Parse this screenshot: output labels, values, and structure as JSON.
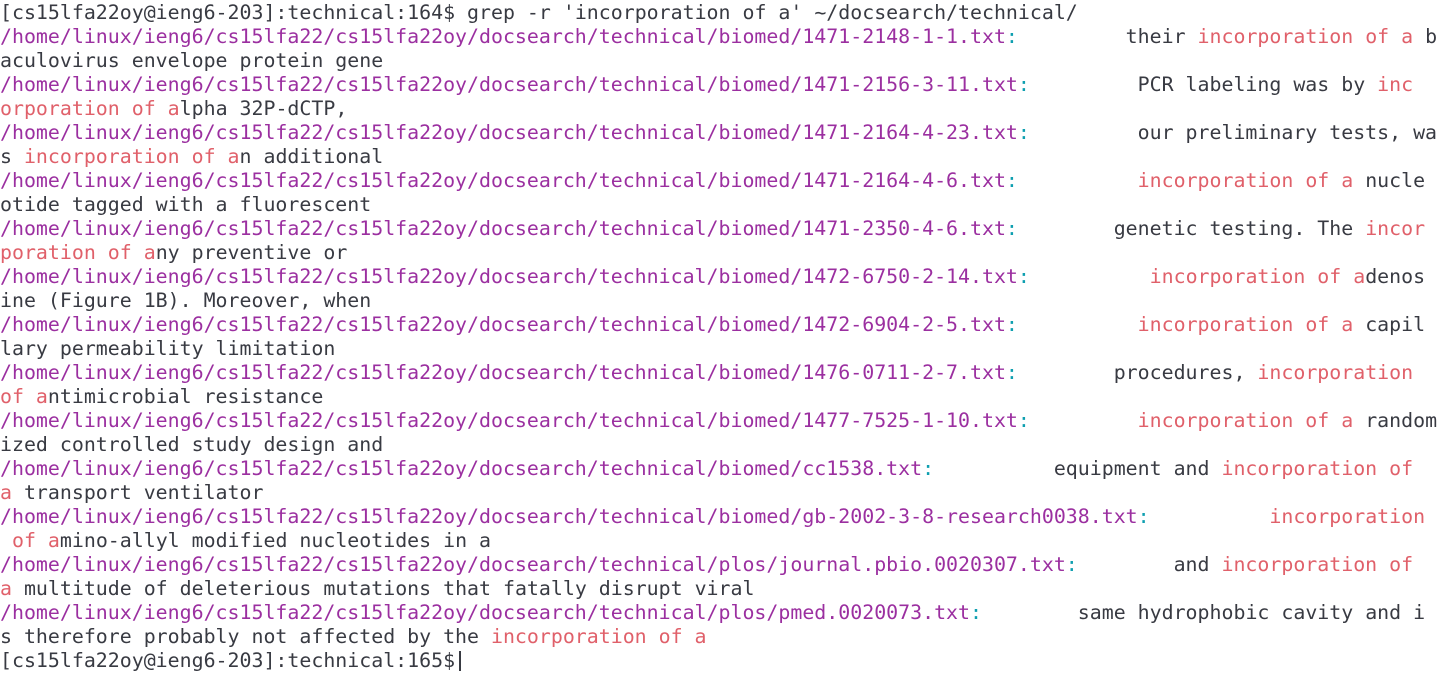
{
  "terminal": {
    "prompt_command": {
      "prompt": "[cs15lfa22oy@ieng6-203]:technical:164$ ",
      "command": "grep -r 'incorporation of a' ~/docsearch/technical/"
    },
    "results": [
      {
        "row1": [
          {
            "k": "path",
            "t": "/home/linux/ieng6/cs15lfa22/cs15lfa22oy/docsearch/technical/biomed/1471-2148-1-1.txt"
          },
          {
            "k": "sep",
            "t": ":"
          },
          {
            "k": "txt",
            "t": "         their "
          },
          {
            "k": "match",
            "t": "incorporation of a"
          },
          {
            "k": "txt",
            "t": " b"
          }
        ],
        "row2": [
          {
            "k": "txt",
            "t": "aculovirus envelope protein gene"
          }
        ]
      },
      {
        "row1": [
          {
            "k": "path",
            "t": "/home/linux/ieng6/cs15lfa22/cs15lfa22oy/docsearch/technical/biomed/1471-2156-3-11.txt"
          },
          {
            "k": "sep",
            "t": ":"
          },
          {
            "k": "txt",
            "t": "         PCR labeling was by "
          },
          {
            "k": "match",
            "t": "inc"
          }
        ],
        "row2": [
          {
            "k": "match",
            "t": "orporation of a"
          },
          {
            "k": "txt",
            "t": "lpha 32P-dCTP,"
          }
        ]
      },
      {
        "row1": [
          {
            "k": "path",
            "t": "/home/linux/ieng6/cs15lfa22/cs15lfa22oy/docsearch/technical/biomed/1471-2164-4-23.txt"
          },
          {
            "k": "sep",
            "t": ":"
          },
          {
            "k": "txt",
            "t": "         our preliminary tests, wa"
          }
        ],
        "row2": [
          {
            "k": "txt",
            "t": "s "
          },
          {
            "k": "match",
            "t": "incorporation of a"
          },
          {
            "k": "txt",
            "t": "n additional"
          }
        ]
      },
      {
        "row1": [
          {
            "k": "path",
            "t": "/home/linux/ieng6/cs15lfa22/cs15lfa22oy/docsearch/technical/biomed/1471-2164-4-6.txt"
          },
          {
            "k": "sep",
            "t": ":"
          },
          {
            "k": "txt",
            "t": "          "
          },
          {
            "k": "match",
            "t": "incorporation of a"
          },
          {
            "k": "txt",
            "t": " nucle"
          }
        ],
        "row2": [
          {
            "k": "txt",
            "t": "otide tagged with a fluorescent"
          }
        ]
      },
      {
        "row1": [
          {
            "k": "path",
            "t": "/home/linux/ieng6/cs15lfa22/cs15lfa22oy/docsearch/technical/biomed/1471-2350-4-6.txt"
          },
          {
            "k": "sep",
            "t": ":"
          },
          {
            "k": "txt",
            "t": "        genetic testing. The "
          },
          {
            "k": "match",
            "t": "incor"
          }
        ],
        "row2": [
          {
            "k": "match",
            "t": "poration of a"
          },
          {
            "k": "txt",
            "t": "ny preventive or"
          }
        ]
      },
      {
        "row1": [
          {
            "k": "path",
            "t": "/home/linux/ieng6/cs15lfa22/cs15lfa22oy/docsearch/technical/biomed/1472-6750-2-14.txt"
          },
          {
            "k": "sep",
            "t": ":"
          },
          {
            "k": "txt",
            "t": "          "
          },
          {
            "k": "match",
            "t": "incorporation of a"
          },
          {
            "k": "txt",
            "t": "denos"
          }
        ],
        "row2": [
          {
            "k": "txt",
            "t": "ine (Figure 1B). Moreover, when"
          }
        ]
      },
      {
        "row1": [
          {
            "k": "path",
            "t": "/home/linux/ieng6/cs15lfa22/cs15lfa22oy/docsearch/technical/biomed/1472-6904-2-5.txt"
          },
          {
            "k": "sep",
            "t": ":"
          },
          {
            "k": "txt",
            "t": "          "
          },
          {
            "k": "match",
            "t": "incorporation of a"
          },
          {
            "k": "txt",
            "t": " capil"
          }
        ],
        "row2": [
          {
            "k": "txt",
            "t": "lary permeability limitation"
          }
        ]
      },
      {
        "row1": [
          {
            "k": "path",
            "t": "/home/linux/ieng6/cs15lfa22/cs15lfa22oy/docsearch/technical/biomed/1476-0711-2-7.txt"
          },
          {
            "k": "sep",
            "t": ":"
          },
          {
            "k": "txt",
            "t": "        procedures, "
          },
          {
            "k": "match",
            "t": "incorporation"
          },
          {
            "k": "txt",
            "t": " "
          }
        ],
        "row2": [
          {
            "k": "match",
            "t": "of a"
          },
          {
            "k": "txt",
            "t": "ntimicrobial resistance"
          }
        ]
      },
      {
        "row1": [
          {
            "k": "path",
            "t": "/home/linux/ieng6/cs15lfa22/cs15lfa22oy/docsearch/technical/biomed/1477-7525-1-10.txt"
          },
          {
            "k": "sep",
            "t": ":"
          },
          {
            "k": "txt",
            "t": "         "
          },
          {
            "k": "match",
            "t": "incorporation of a"
          },
          {
            "k": "txt",
            "t": " random"
          }
        ],
        "row2": [
          {
            "k": "txt",
            "t": "ized controlled study design and"
          }
        ]
      },
      {
        "row1": [
          {
            "k": "path",
            "t": "/home/linux/ieng6/cs15lfa22/cs15lfa22oy/docsearch/technical/biomed/cc1538.txt"
          },
          {
            "k": "sep",
            "t": ":"
          },
          {
            "k": "txt",
            "t": "          equipment and "
          },
          {
            "k": "match",
            "t": "incorporation of"
          },
          {
            "k": "txt",
            "t": " "
          }
        ],
        "row2": [
          {
            "k": "match",
            "t": "a"
          },
          {
            "k": "txt",
            "t": " transport ventilator"
          }
        ]
      },
      {
        "row1": [
          {
            "k": "path",
            "t": "/home/linux/ieng6/cs15lfa22/cs15lfa22oy/docsearch/technical/biomed/gb-2002-3-8-research0038.txt"
          },
          {
            "k": "sep",
            "t": ":"
          },
          {
            "k": "txt",
            "t": "          "
          },
          {
            "k": "match",
            "t": "incorporation"
          }
        ],
        "row2": [
          {
            "k": "txt",
            "t": " "
          },
          {
            "k": "match",
            "t": "of a"
          },
          {
            "k": "txt",
            "t": "mino-allyl modified nucleotides in a"
          }
        ]
      },
      {
        "row1": [
          {
            "k": "path",
            "t": "/home/linux/ieng6/cs15lfa22/cs15lfa22oy/docsearch/technical/plos/journal.pbio.0020307.txt"
          },
          {
            "k": "sep",
            "t": ":"
          },
          {
            "k": "txt",
            "t": "        and "
          },
          {
            "k": "match",
            "t": "incorporation of"
          },
          {
            "k": "txt",
            "t": " "
          }
        ],
        "row2": [
          {
            "k": "match",
            "t": "a"
          },
          {
            "k": "txt",
            "t": " multitude of deleterious mutations that fatally disrupt viral"
          }
        ]
      },
      {
        "row1": [
          {
            "k": "path",
            "t": "/home/linux/ieng6/cs15lfa22/cs15lfa22oy/docsearch/technical/plos/pmed.0020073.txt"
          },
          {
            "k": "sep",
            "t": ":"
          },
          {
            "k": "txt",
            "t": "        same hydrophobic cavity and i"
          }
        ],
        "row2": [
          {
            "k": "txt",
            "t": "s therefore probably not affected by the "
          },
          {
            "k": "match",
            "t": "incorporation of a"
          }
        ]
      }
    ],
    "final_prompt": "[cs15lfa22oy@ieng6-203]:technical:165$"
  },
  "colors": {
    "background": "#ffffff",
    "text": "#383a42",
    "path": "#9b2fa0",
    "separator": "#0e9fb0",
    "match": "#e0606a"
  }
}
